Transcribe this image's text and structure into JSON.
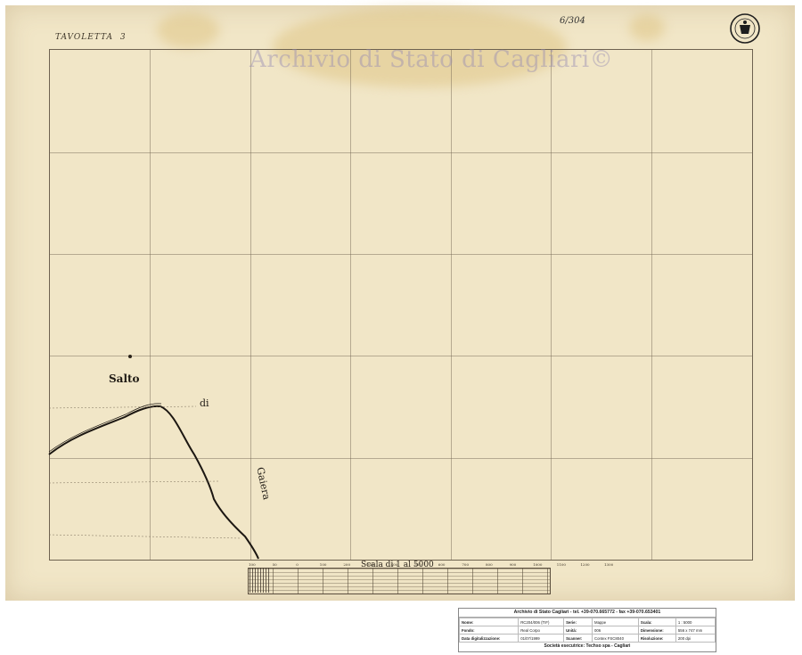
{
  "sheet": {
    "title_word": "TAVOLETTA",
    "title_number": "3",
    "watermark": "Archivio di Stato di Cagliari©",
    "reference": "6/304"
  },
  "places": {
    "salto": "Salto",
    "di": "di",
    "gaiera": "Gaiera"
  },
  "scale": {
    "title": "Scala di 1 al 5000",
    "ticks": [
      "100",
      "50",
      "0",
      "100",
      "200",
      "300",
      "400",
      "500",
      "600",
      "700",
      "800",
      "900",
      "1000",
      "1100",
      "1200",
      "1300"
    ]
  },
  "info": {
    "header": "Archivio di Stato Cagliari - tel. +39-070.665772 - fax +39-070.653401",
    "rows": [
      [
        "Nome:",
        "RC204/006 (TIF)",
        "Serie:",
        "Mappe",
        "Scala:",
        "1 : 5000"
      ],
      [
        "Fondo:",
        "Real Corpo",
        "Unità:",
        "006",
        "Dimensione:",
        "556 x 747 mm"
      ],
      [
        "Data digitalizzazione:",
        "01/07/1999",
        "Scanner:",
        "Contex FSC8040",
        "Risoluzione:",
        "200 dpi"
      ]
    ],
    "footer": "Società esecutrice: Techso spa - Cagliari"
  },
  "colors": {
    "paper": "#f1e6c7",
    "ink": "#2a231a",
    "watermark": "#968cb4"
  }
}
